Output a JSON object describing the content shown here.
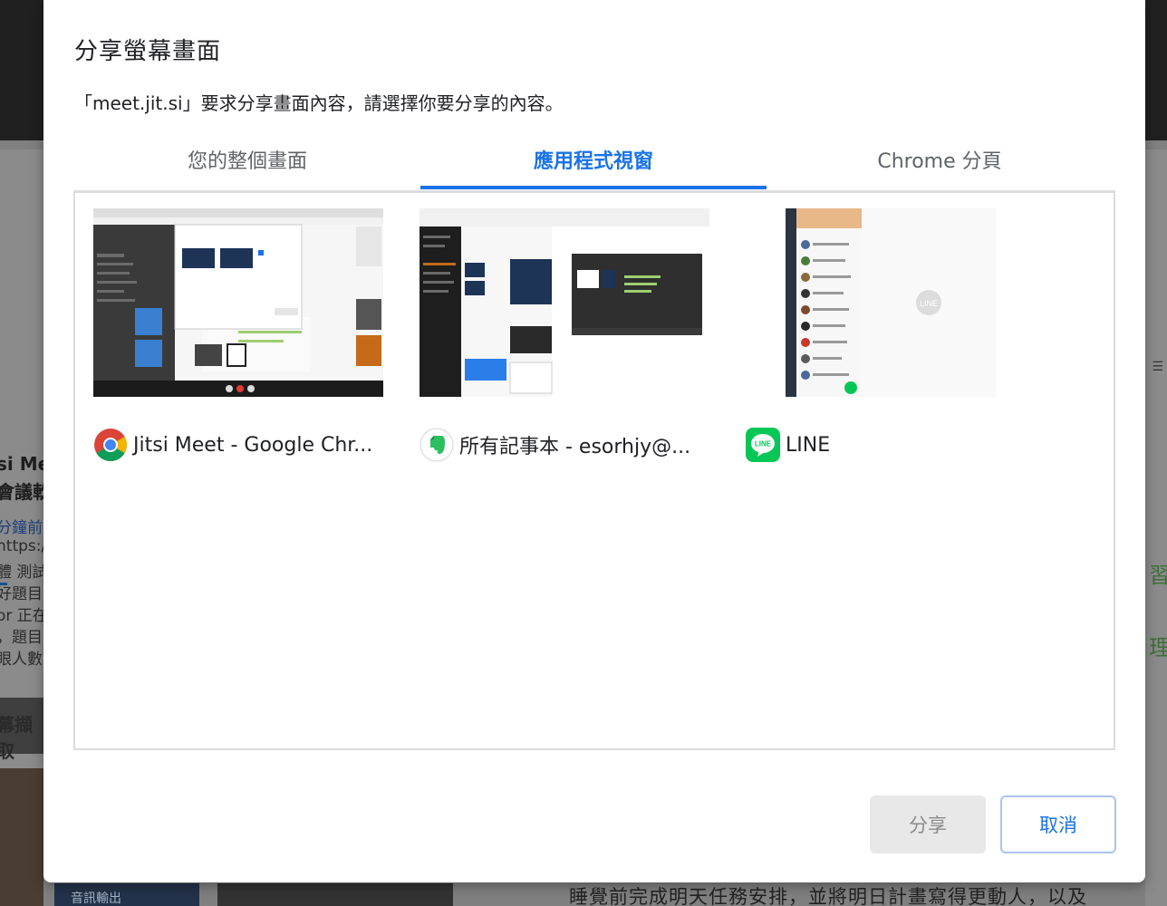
{
  "dialog": {
    "title": "分享螢幕畫面",
    "description": "「meet.jit.si」要求分享畫面內容，請選擇你要分享的內容。",
    "tabs": [
      {
        "label": "您的整個畫面",
        "active": false
      },
      {
        "label": "應用程式視窗",
        "active": true
      },
      {
        "label": "Chrome 分頁",
        "active": false
      }
    ],
    "sources": [
      {
        "label": "Jitsi Meet - Google Chr...",
        "icon": "chrome-icon"
      },
      {
        "label": "所有記事本 - esorhjy@...",
        "icon": "evernote-icon"
      },
      {
        "label": "LINE",
        "icon": "line-icon"
      }
    ],
    "buttons": {
      "share": "分享",
      "cancel": "取消"
    }
  },
  "background": {
    "left_lines": [
      "si Me",
      "會議軟",
      "分鐘前",
      "https:/",
      "體 測試",
      "好題目",
      "or 正在",
      "，題目",
      "眼人數"
    ],
    "left_heading": "幕擷取",
    "right_glyphs": [
      "習",
      "理"
    ],
    "bottom_bar_label": "音訊輸出",
    "bottom_text": "睡覺前完成明天任務安排，並將明日計畫寫得更動人，以及"
  },
  "colors": {
    "accent": "#1a73e8",
    "line_green": "#06c755",
    "evernote_green": "#2dbe60"
  }
}
